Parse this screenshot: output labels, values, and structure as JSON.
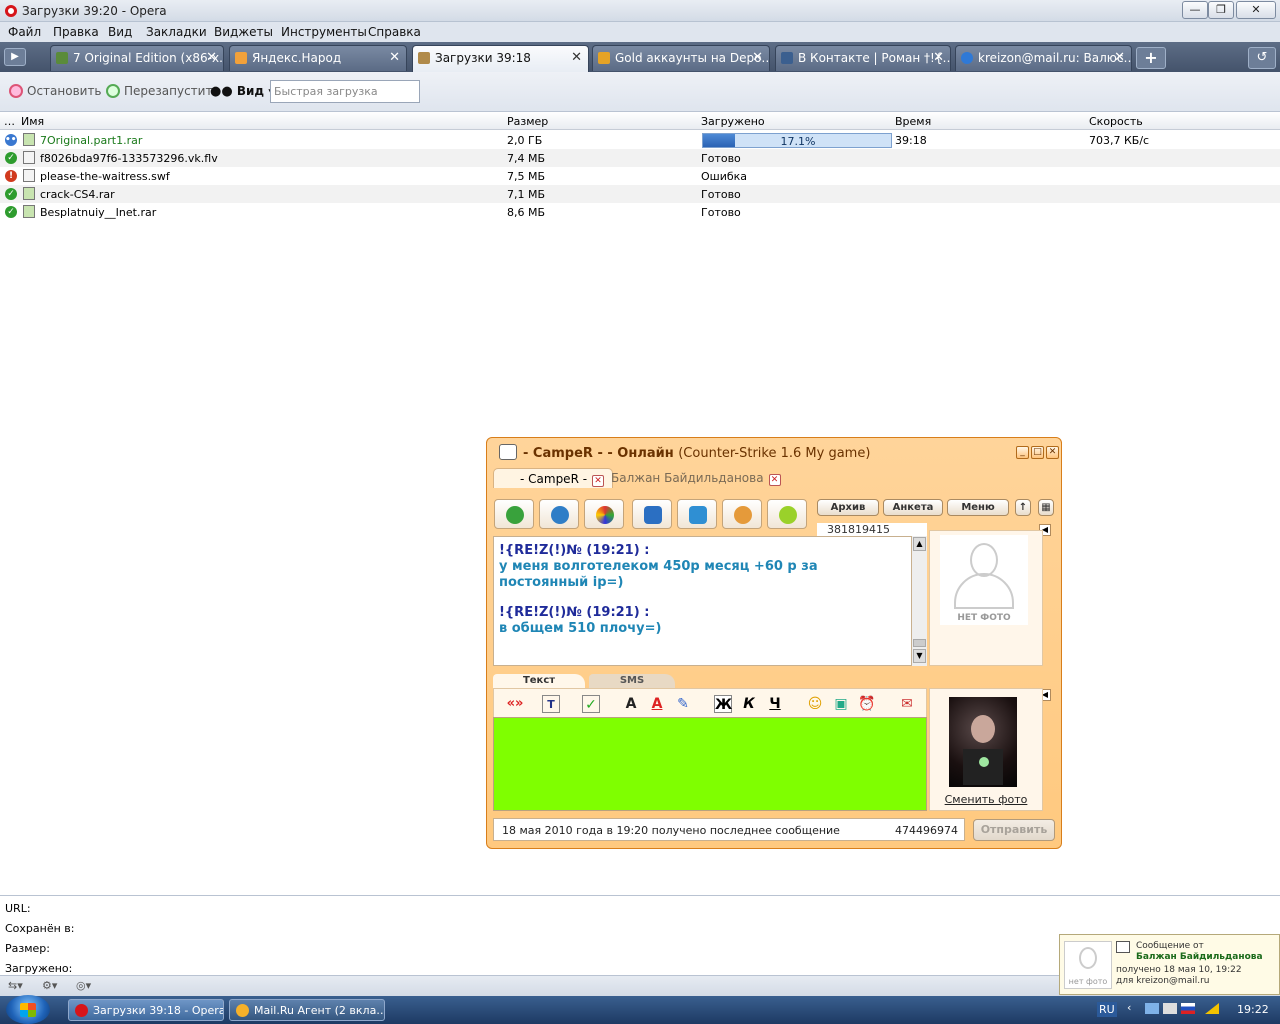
{
  "window": {
    "title": "Загрузки 39:20 - Opera",
    "buttons": [
      "—",
      "❐",
      "✕"
    ]
  },
  "menu": [
    "Файл",
    "Правка",
    "Вид",
    "Закладки",
    "Виджеты",
    "Инструменты",
    "Справка"
  ],
  "tabs": [
    {
      "label": "7 Original Edition (x86-x…",
      "active": false
    },
    {
      "label": "Яндекс.Народ",
      "active": false
    },
    {
      "label": "Загрузки 39:18",
      "active": true
    },
    {
      "label": "Gold аккаунты на Depo…",
      "active": false
    },
    {
      "label": "В Контакте | Роман †!{…",
      "active": false
    },
    {
      "label": "kreizon@mail.ru: Валюс…",
      "active": false
    }
  ],
  "toolbar": {
    "stop": "Остановить",
    "restart": "Перезапустить",
    "view": "Вид",
    "quick_placeholder": "Быстрая загрузка"
  },
  "columns": {
    "dots": "…",
    "name": "Имя",
    "size": "Размер",
    "loaded": "Загружено",
    "time": "Время",
    "speed": "Скорость"
  },
  "downloads": [
    {
      "status": "active",
      "name": "7Original.part1.rar",
      "size": "2,0 ГБ",
      "loaded": "17.1%",
      "progress": 0.171,
      "time": "39:18",
      "speed": "703,7 КБ/с"
    },
    {
      "status": "done",
      "name": "f8026bda97f6-133573296.vk.flv",
      "size": "7,4 МБ",
      "loaded": "Готово",
      "time": "",
      "speed": ""
    },
    {
      "status": "error",
      "name": "please-the-waitress.swf",
      "size": "7,5 МБ",
      "loaded": "Ошибка",
      "time": "",
      "speed": ""
    },
    {
      "status": "done",
      "name": "crack-CS4.rar",
      "size": "7,1 МБ",
      "loaded": "Готово",
      "time": "",
      "speed": ""
    },
    {
      "status": "done",
      "name": "Besplatnuiy__Inet.rar",
      "size": "8,6 МБ",
      "loaded": "Готово",
      "time": "",
      "speed": ""
    }
  ],
  "details": {
    "url": "URL:",
    "saved": "Сохранён в:",
    "size": "Размер:",
    "loaded": "Загружено:"
  },
  "agent": {
    "title": "- CampeR - - Онлайн",
    "title_status": "(Counter-Strike 1.6 My game)",
    "tabs": [
      "- CampeR -",
      "Балжан Байдильданова"
    ],
    "buttons": {
      "archive": "Архив",
      "profile": "Анкета",
      "menu": "Меню"
    },
    "uin": "381819415",
    "messages": [
      {
        "nick": "!{RE!Z(!)№ (19:21) :",
        "text": "у меня волготелеком 450р месяц +60 р за постоянный ip=)"
      },
      {
        "nick": "!{RE!Z(!)№ (19:21) :",
        "text": "в общем 510 плочу=)"
      }
    ],
    "no_photo": "НЕТ ФОТО",
    "edit_tabs": [
      "Текст",
      "SMS"
    ],
    "format_tools": [
      "«»",
      "Т",
      "✓",
      "A",
      "A",
      "✎",
      "Ж",
      "К",
      "Ч",
      "☺",
      "▣",
      "⏰",
      "✉"
    ],
    "change_photo": "Сменить фото",
    "status_line": "18 мая 2010 года в 19:20 получено последнее сообщение",
    "uin2": "474496974",
    "send": "Отправить"
  },
  "notification": {
    "title": "Сообщение от",
    "from": "Балжан Байдильданова",
    "received": "получено  18 мая 10, 19:22",
    "to": "для kreizon@mail.ru",
    "no_photo": "нет фото"
  },
  "taskbar": {
    "tasks": [
      "Загрузки 39:18 - Opera",
      "Mail.Ru Агент (2 вкла…"
    ],
    "lang": "RU",
    "clock": "19:22"
  },
  "colors": {
    "agent_bg": "#ffc97f",
    "input_bg": "#7fff00",
    "progress": "#2a62b4"
  }
}
